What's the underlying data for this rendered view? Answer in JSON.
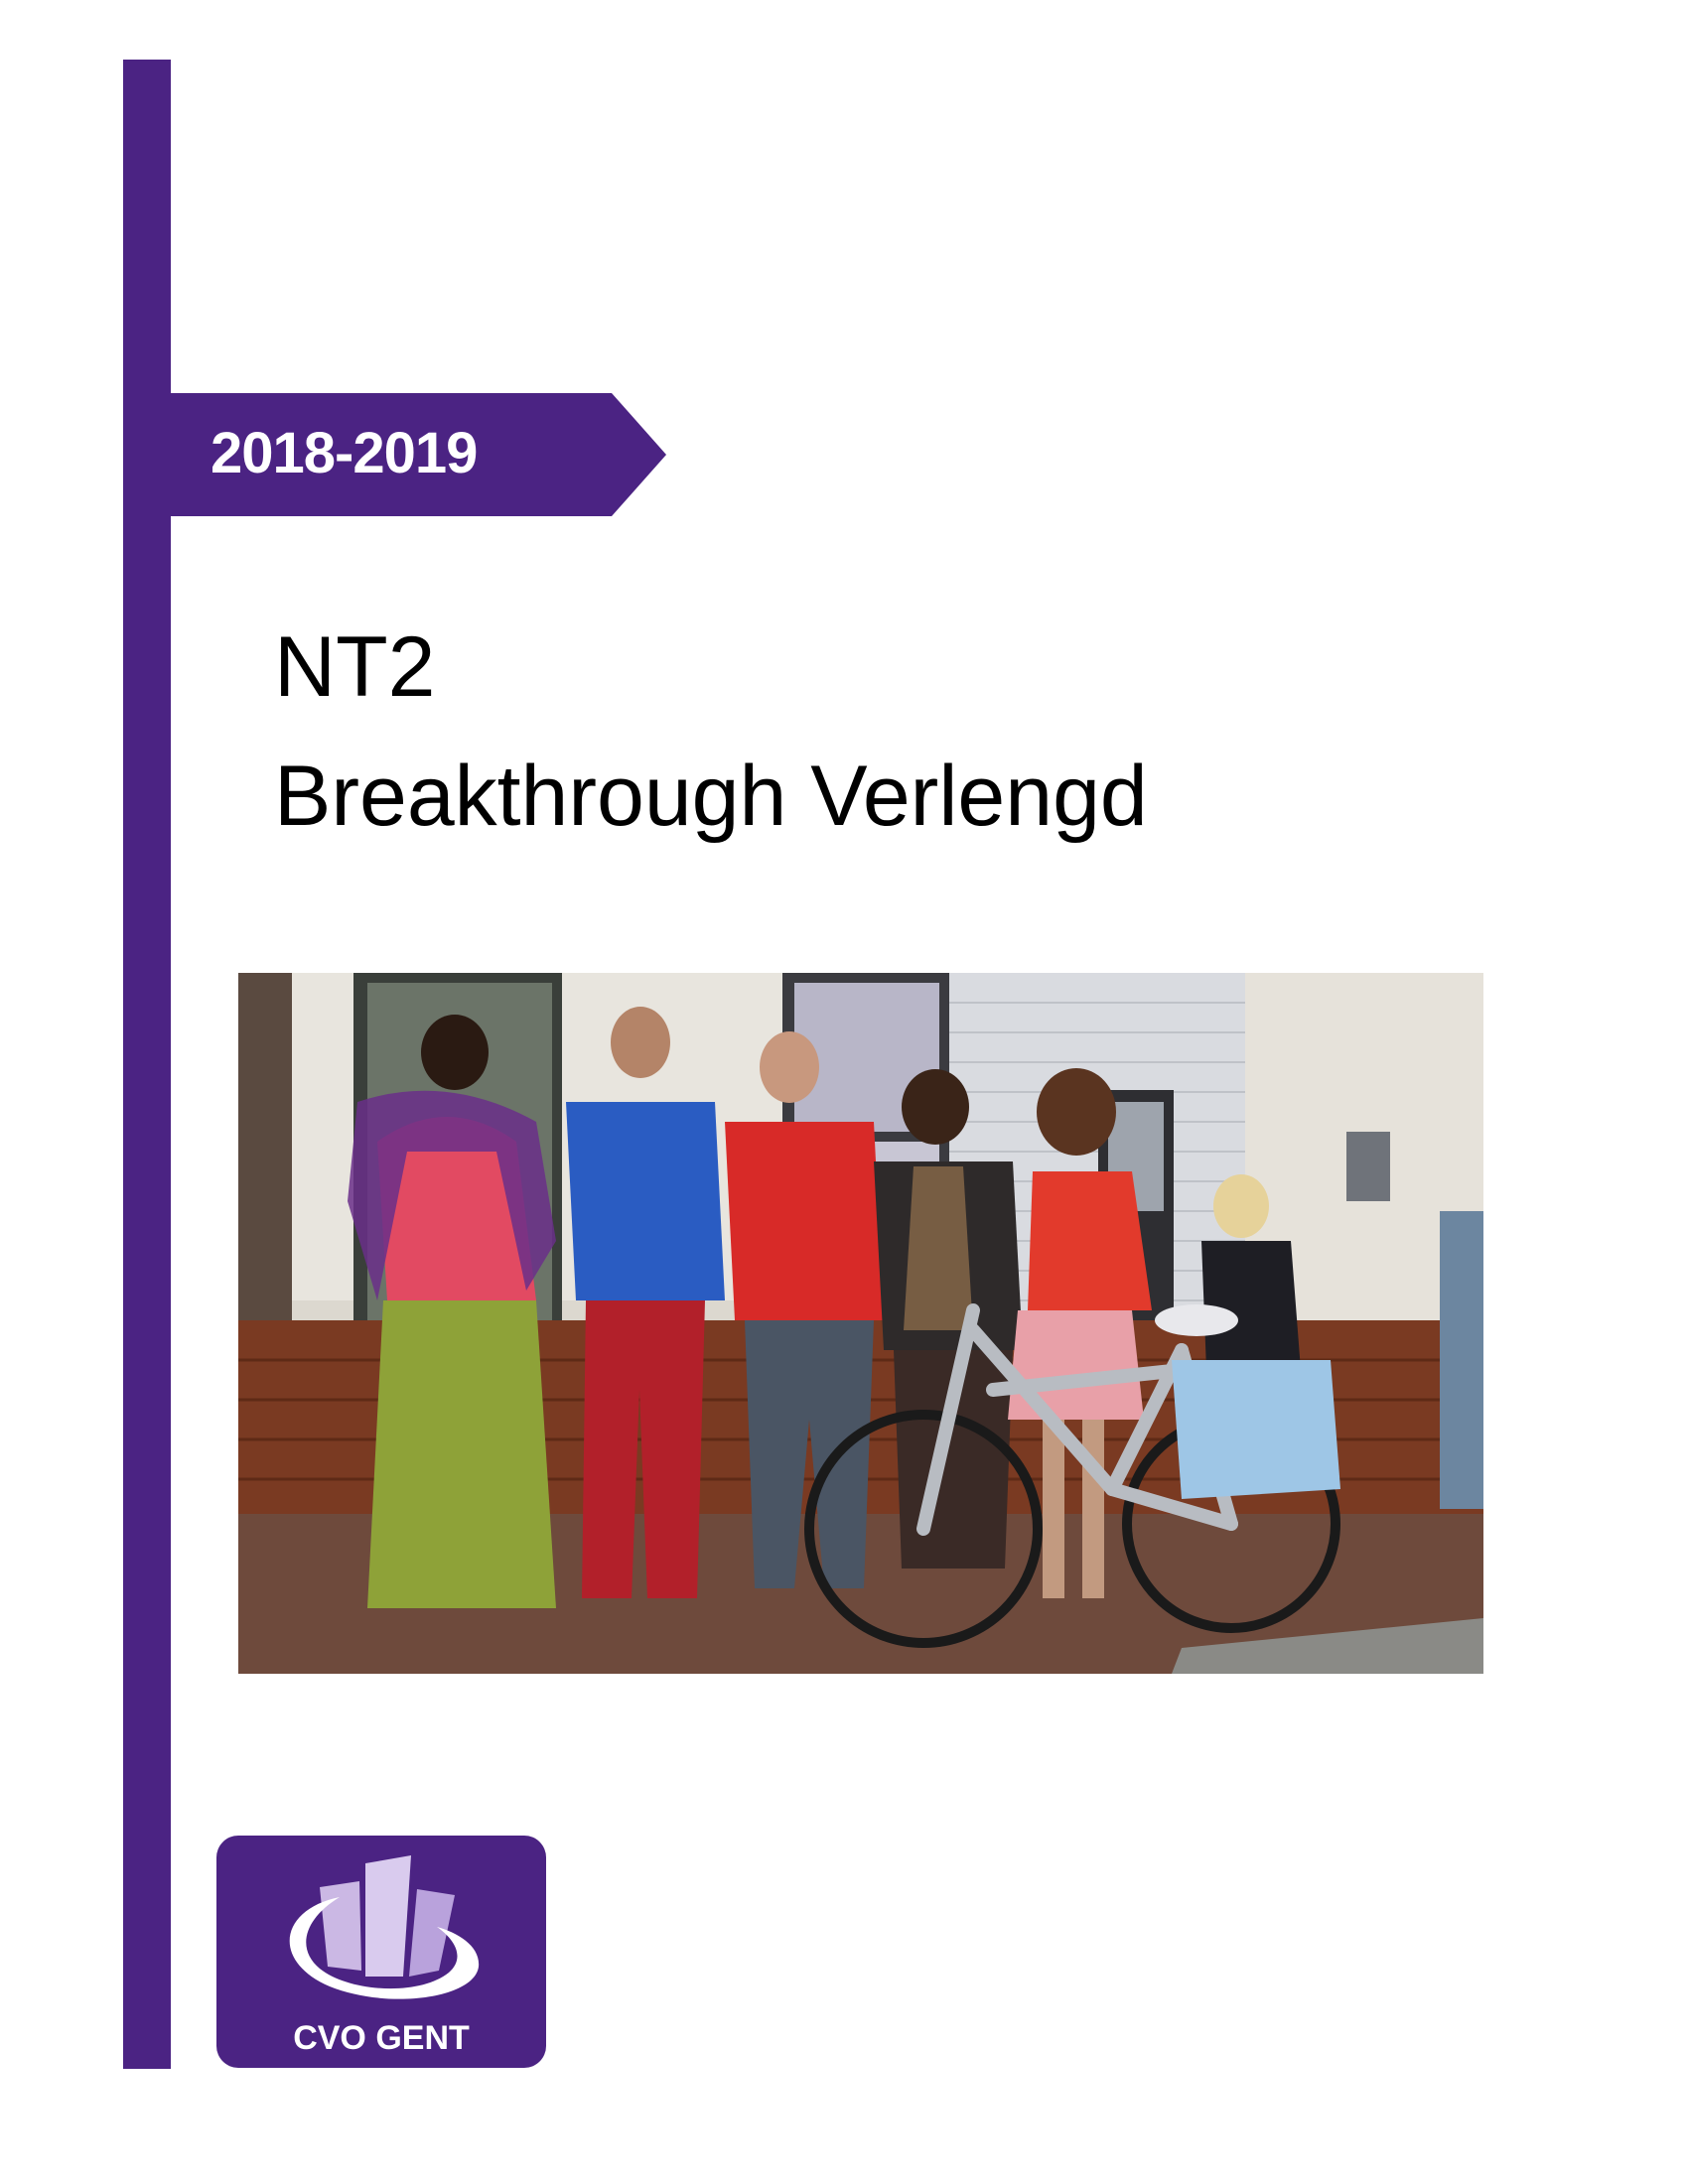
{
  "cover": {
    "year": "2018-2019",
    "title_line1": "NT2",
    "title_line2": "Breakthrough Verlengd"
  },
  "logo": {
    "text": "CVO GENT"
  },
  "colors": {
    "brand_purple": "#4b2383",
    "title_text": "#000000",
    "background": "#ffffff"
  }
}
